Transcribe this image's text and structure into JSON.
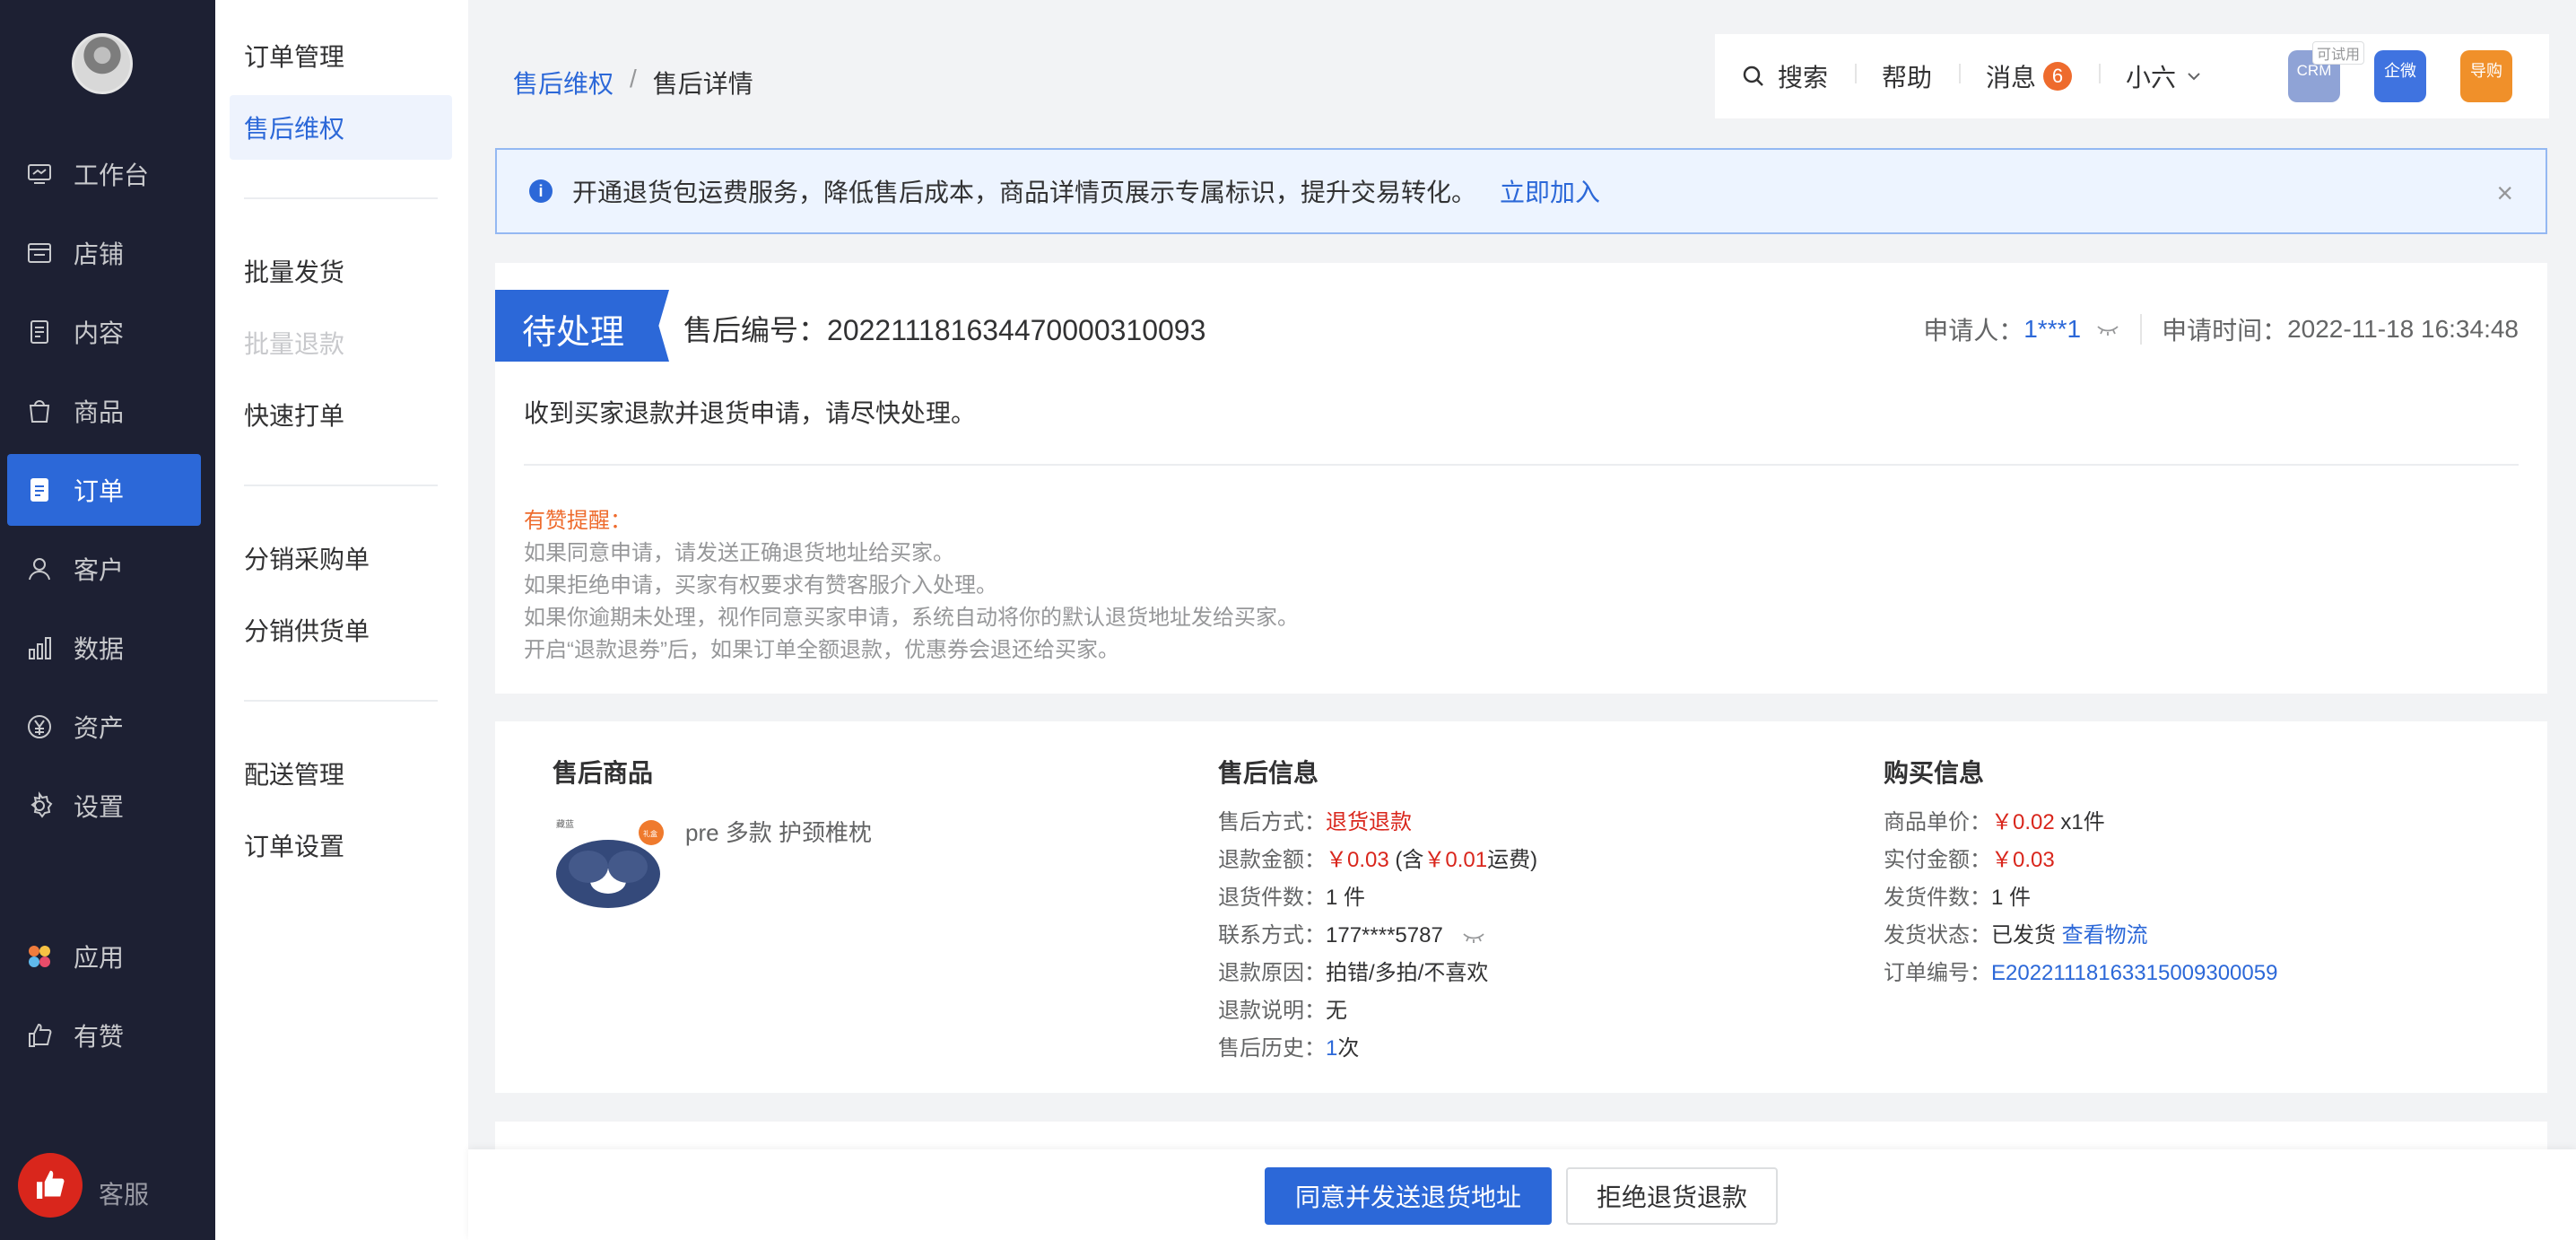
{
  "nav": {
    "items": [
      {
        "label": "工作台",
        "icon": "workbench-icon"
      },
      {
        "label": "店铺",
        "icon": "store-icon"
      },
      {
        "label": "内容",
        "icon": "content-icon"
      },
      {
        "label": "商品",
        "icon": "goods-icon"
      },
      {
        "label": "订单",
        "icon": "order-icon",
        "active": true
      },
      {
        "label": "客户",
        "icon": "customer-icon"
      },
      {
        "label": "数据",
        "icon": "data-icon"
      },
      {
        "label": "资产",
        "icon": "assets-icon"
      },
      {
        "label": "设置",
        "icon": "settings-icon"
      },
      {
        "label": "应用",
        "icon": "apps-icon"
      },
      {
        "label": "有赞",
        "icon": "youzan-icon"
      }
    ],
    "service_label": "客服"
  },
  "subnav": {
    "items": [
      {
        "label": "订单管理"
      },
      {
        "label": "售后维权",
        "active": true
      },
      {
        "label": "批量发货"
      },
      {
        "label": "批量退款",
        "disabled": true
      },
      {
        "label": "快速打单"
      },
      {
        "label": "分销采购单"
      },
      {
        "label": "分销供货单"
      },
      {
        "label": "配送管理"
      },
      {
        "label": "订单设置"
      }
    ]
  },
  "breadcrumb": {
    "parent": "售后维权",
    "separator": "/",
    "current": "售后详情"
  },
  "topbar": {
    "search": "搜索",
    "help": "帮助",
    "messages": "消息",
    "message_count": "6",
    "user": "小六",
    "apps": [
      {
        "label": "CRM",
        "tag": "可试用",
        "color": "#8fa3d6"
      },
      {
        "label": "企微",
        "color": "#3f73e0"
      },
      {
        "label": "导购",
        "color": "#f0902a"
      }
    ]
  },
  "notice": {
    "text": "开通退货包运费服务，降低售后成本，商品详情页展示专属标识，提升交易转化。",
    "link": "立即加入",
    "close": "×"
  },
  "case": {
    "status": "待处理",
    "number_label": "售后编号：",
    "number": "2022111816344700003100 93",
    "applicant_label": "申请人：",
    "applicant": "1***1",
    "time_label": "申请时间：",
    "time": "2022-11-18 16:34:48",
    "message": "收到买家退款并退货申请，请尽快处理。",
    "tips_title": "有赞提醒：",
    "tips": [
      "如果同意申请，请发送正确退货地址给买家。",
      "如果拒绝申请，买家有权要求有赞客服介入处理。",
      "如果你逾期未处理，视作同意买家申请，系统自动将你的默认退货地址发给买家。",
      "开启“退款退券”后，如果订单全额退款，优惠券会退还给买家。"
    ]
  },
  "product": {
    "title": "售后商品",
    "name": "pre 多款 护颈椎枕",
    "img_tag": "藏蓝",
    "img_badge": "礼盒"
  },
  "aftersale": {
    "title": "售后信息",
    "method_label": "售后方式：",
    "method": "退货退款",
    "amount_label": "退款金额：",
    "amount": "￥0.03",
    "amount_note_prefix": "(含",
    "amount_freight": "￥0.01",
    "amount_note_suffix": "运费)",
    "count_label": "退货件数：",
    "count": "1 件",
    "contact_label": "联系方式：",
    "contact": "177****5787",
    "reason_label": "退款原因：",
    "reason": "拍错/多拍/不喜欢",
    "desc_label": "退款说明：",
    "desc": "无",
    "history_label": "售后历史：",
    "history_num": "1",
    "history_unit": "次"
  },
  "purchase": {
    "title": "购买信息",
    "price_label": "商品单价：",
    "price": "￥0.02",
    "qty": "x1件",
    "paid_label": "实付金额：",
    "paid": "￥0.03",
    "ship_count_label": "发货件数：",
    "ship_count": "1 件",
    "ship_status_label": "发货状态：",
    "ship_status": "已发货",
    "logistics_link": "查看物流",
    "order_no_label": "订单编号：",
    "order_no": "E20221118163315009300059"
  },
  "actions": {
    "agree": "同意并发送退货地址",
    "reject": "拒绝退货退款"
  }
}
